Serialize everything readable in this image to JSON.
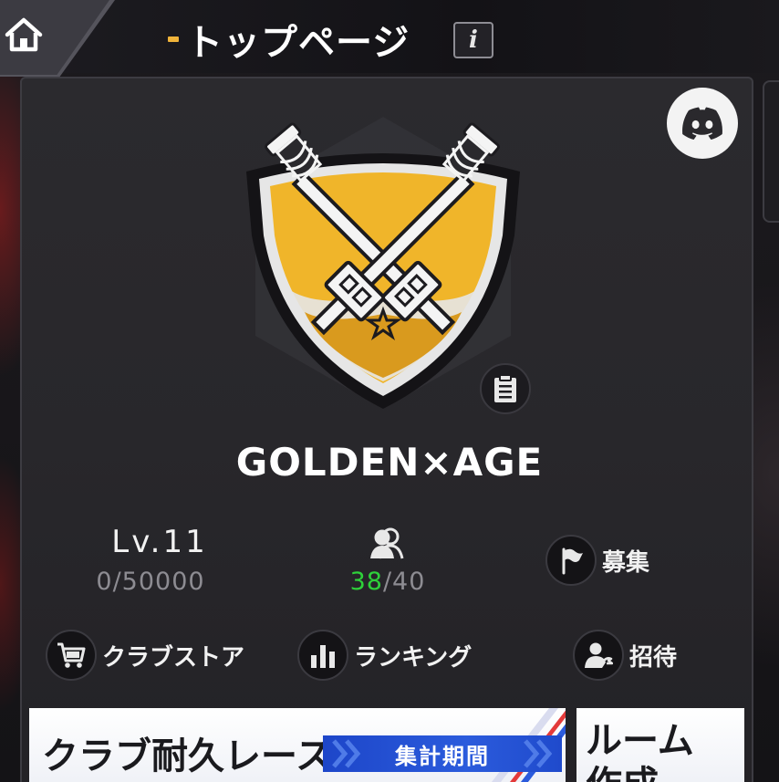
{
  "header": {
    "title": "トップページ",
    "info_label": "i",
    "home_icon": "home-icon"
  },
  "club": {
    "name": "GOLDEN×AGE",
    "level_label": "Lv.11",
    "exp": "0/50000",
    "members_current": "38",
    "members_separator": "/",
    "members_max": "40",
    "emblem_colors": {
      "gold": "#f0b52a",
      "silver": "#e6e6e6",
      "dark": "#2a292d"
    }
  },
  "actions": {
    "recruit": {
      "label": "募集",
      "icon": "flag-icon"
    },
    "store": {
      "label": "クラブストア",
      "icon": "cart-icon"
    },
    "ranking": {
      "label": "ランキング",
      "icon": "bar-chart-icon"
    },
    "invite": {
      "label": "招待",
      "icon": "add-user-icon"
    }
  },
  "discord": {
    "icon": "discord-icon"
  },
  "banner": {
    "title": "クラブ耐久レース",
    "period_label": "集計期間"
  },
  "room": {
    "label_line1": "ルーム",
    "label_line2": "作成"
  },
  "colors": {
    "accent_gold": "#f0b33a",
    "members_green": "#2ed13a",
    "badge_blue": "#2b5bdc"
  }
}
